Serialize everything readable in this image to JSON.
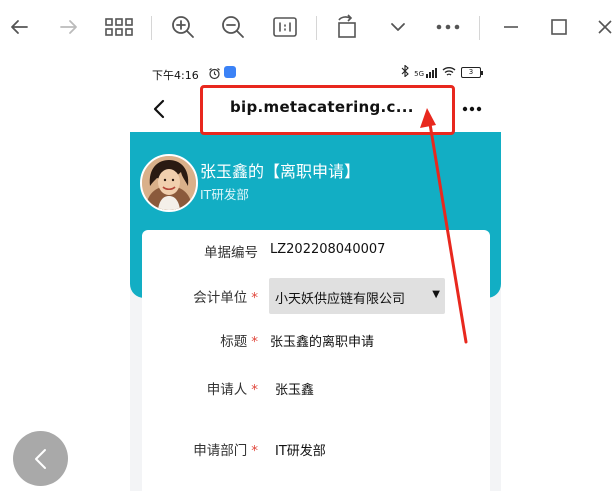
{
  "toolbar": {
    "buttons": [
      "back-icon",
      "forward-icon",
      "grid-icon",
      "zoom-in-icon",
      "zoom-out-icon",
      "actual-size-icon",
      "rotate-icon",
      "chevron-down-icon",
      "more-icon",
      "minimize-icon",
      "maximize-icon",
      "close-icon"
    ]
  },
  "statusbar": {
    "time": "下午4:16",
    "signal_text": "5G",
    "battery": "3"
  },
  "navbar": {
    "title": "bip.metacatering.c..."
  },
  "header": {
    "title": "张玉鑫的【离职申请】",
    "dept": "IT研发部"
  },
  "form": {
    "doc_no_label": "单据编号",
    "doc_no_value": "LZ202208040007",
    "unit_label": "会计单位",
    "unit_value": "小天妖供应链有限公司",
    "title_label": "标题",
    "title_value": "张玉鑫的离职申请",
    "applicant_label": "申请人",
    "applicant_value": "张玉鑫",
    "dept_label": "申请部门",
    "dept_value": "IT研发部",
    "required_mark": "*"
  },
  "colors": {
    "accent": "#12aec4",
    "annotation": "#e8281e"
  }
}
